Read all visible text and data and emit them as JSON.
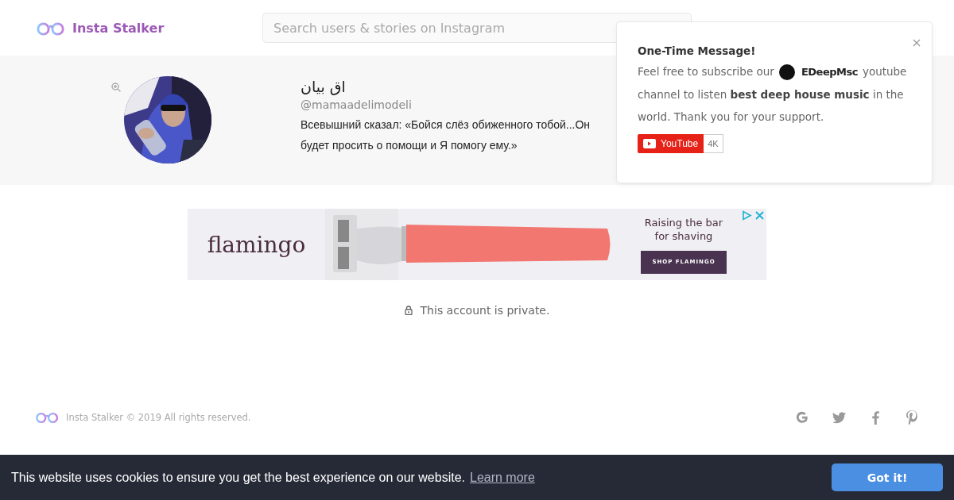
{
  "header": {
    "brand": "Insta Stalker",
    "search": {
      "placeholder": "Search users & stories on Instagram"
    }
  },
  "profile": {
    "name": "اق بیان",
    "username": "@mamaadelimodeli",
    "bio": "Всевышний сказал: «Бойся слёз обиженного тобой...Он будет просить о помощи и Я помогу ему.»"
  },
  "popup": {
    "title": "One-Time Message!",
    "text_before": "Feel free to subscribe our",
    "channel": "EDeepMsc",
    "text_after": "youtube channel to listen **best deep house music** in the world. Thank you for your support.",
    "youtube_button": "YouTube",
    "subscriber_count": "4K"
  },
  "ad": {
    "brand": "flamingo",
    "tagline": "Raising the bar for shaving",
    "button": "SHOP FLAMINGO"
  },
  "private_notice": "This account is private.",
  "footer": {
    "copyright": "Insta Stalker © 2019 All rights reserved.",
    "social": [
      {
        "kind": "google"
      },
      {
        "kind": "twitter"
      },
      {
        "kind": "facebook"
      },
      {
        "kind": "pinterest"
      }
    ]
  },
  "cookie_bar": {
    "message": "This website uses cookies to ensure you get the best experience on our website.",
    "link": "Learn more",
    "button": "Got it!"
  }
}
